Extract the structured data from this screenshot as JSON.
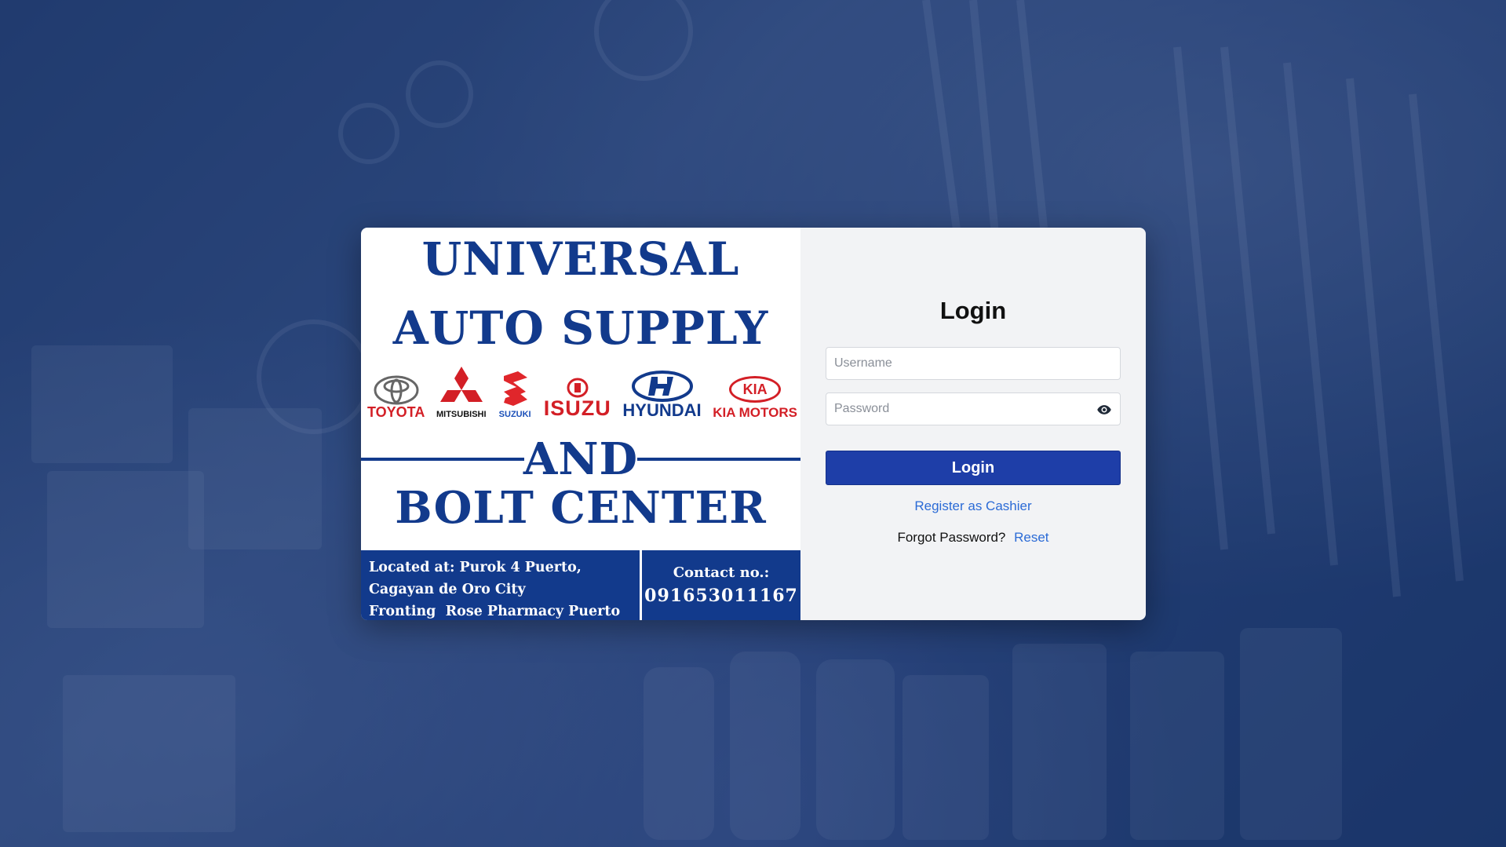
{
  "banner": {
    "title_line1": "UNIVERSAL",
    "title_line2": "AUTO SUPPLY",
    "title_line3": "AND",
    "title_line4": "BOLT CENTER",
    "brands": [
      {
        "name": "TOYOTA",
        "color": "#d31f26"
      },
      {
        "name": "MITSUBISHI",
        "color": "#111111"
      },
      {
        "name": "SUZUKI",
        "color": "#1a4fb8"
      },
      {
        "name": "ISUZU",
        "color": "#d31f26"
      },
      {
        "name": "HYUNDAI",
        "color": "#123a8c"
      },
      {
        "name": "KIA MOTORS",
        "color": "#d31f26"
      }
    ],
    "kia_badge": "KIA",
    "location_line1": "Located at: Purok 4 Puerto,",
    "location_line2": "Cagayan de Oro City",
    "location_line3": "Fronting  Rose Pharmacy Puerto",
    "contact_label": "Contact no.:",
    "contact_number": "091653011167"
  },
  "login_form": {
    "heading": "Login",
    "username_placeholder": "Username",
    "password_placeholder": "Password",
    "submit_label": "Login",
    "register_link": "Register as Cashier",
    "forgot_text": "Forgot Password?",
    "reset_link": "Reset"
  },
  "colors": {
    "brand_blue": "#123a8c",
    "button_blue": "#1e3ea8",
    "link_blue": "#2b6bd6"
  }
}
